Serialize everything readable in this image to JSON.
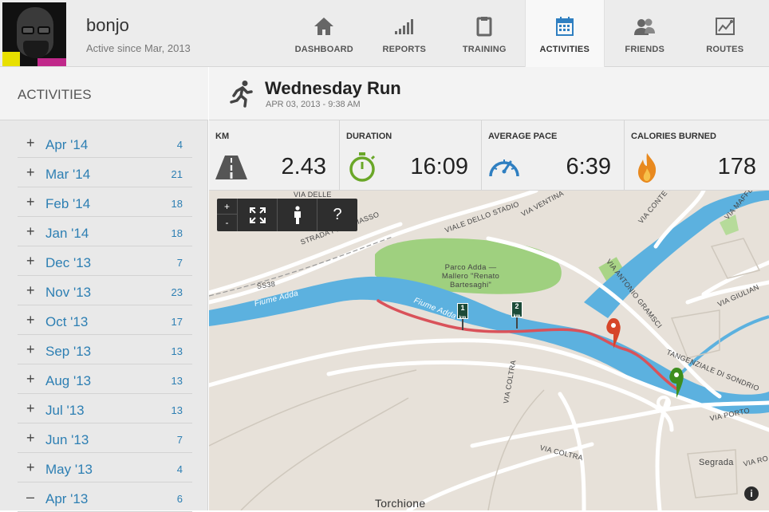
{
  "user": {
    "name": "bonjo",
    "since": "Active since Mar, 2013"
  },
  "nav": {
    "tabs": [
      {
        "label": "DASHBOARD",
        "icon": "home-icon"
      },
      {
        "label": "REPORTS",
        "icon": "bar-chart-icon"
      },
      {
        "label": "TRAINING",
        "icon": "clipboard-icon"
      },
      {
        "label": "ACTIVITIES",
        "icon": "calendar-icon",
        "active": true
      },
      {
        "label": "FRIENDS",
        "icon": "friends-icon"
      },
      {
        "label": "ROUTES",
        "icon": "route-map-icon"
      }
    ]
  },
  "sidebar": {
    "title": "ACTIVITIES",
    "months": [
      {
        "sign": "+",
        "label": "Apr '14",
        "count": "4"
      },
      {
        "sign": "+",
        "label": "Mar '14",
        "count": "21"
      },
      {
        "sign": "+",
        "label": "Feb '14",
        "count": "18"
      },
      {
        "sign": "+",
        "label": "Jan '14",
        "count": "18"
      },
      {
        "sign": "+",
        "label": "Dec '13",
        "count": "7"
      },
      {
        "sign": "+",
        "label": "Nov '13",
        "count": "23"
      },
      {
        "sign": "+",
        "label": "Oct '13",
        "count": "17"
      },
      {
        "sign": "+",
        "label": "Sep '13",
        "count": "13"
      },
      {
        "sign": "+",
        "label": "Aug '13",
        "count": "13"
      },
      {
        "sign": "+",
        "label": "Jul '13",
        "count": "13"
      },
      {
        "sign": "+",
        "label": "Jun '13",
        "count": "7"
      },
      {
        "sign": "+",
        "label": "May '13",
        "count": "4"
      },
      {
        "sign": "–",
        "label": "Apr '13",
        "count": "6"
      }
    ]
  },
  "activity": {
    "title": "Wednesday Run",
    "date": "APR 03, 2013  -  9:38 AM",
    "icon": "runner-icon"
  },
  "stats": [
    {
      "label": "KM",
      "value": "2.43",
      "icon": "road-icon"
    },
    {
      "label": "DURATION",
      "value": "16:09",
      "icon": "stopwatch-icon"
    },
    {
      "label": "AVERAGE PACE",
      "value": "6:39",
      "icon": "speedometer-icon"
    },
    {
      "label": "CALORIES BURNED",
      "value": "178",
      "icon": "flame-icon"
    }
  ],
  "map": {
    "toolbar": {
      "zoom_in": "+",
      "zoom_out": "-",
      "help": "?"
    },
    "km_markers": [
      "1 km",
      "2 km"
    ],
    "labels": {
      "park": "Parco Adda — Mallero \"Renato Bartesaghi\"",
      "river1": "Fiume Adda",
      "river2": "Fiume Adda",
      "viale_stadio": "VIALE DELLO STADIO",
      "via_ventina": "VIA VENTINA",
      "strada_triasso": "STRADA PER TRIASSO",
      "ss38": "SS38",
      "via_delle": "VIA DELLE",
      "via_gramsci": "VIA ANTONIO GRAMSCI",
      "via_cl": "VIA CONTE L",
      "via_maffei": "VIA MAFFE",
      "via_giuliani": "VIA GIULIAN",
      "tangenziale": "TANGENZIALE DI SONDRIO",
      "via_porto": "VIA PORTO",
      "via_coltra1": "VIA COLTRA",
      "via_coltra2": "VIA COLTRA",
      "segrada": "Segrada",
      "via_ro": "VIA RO",
      "torchione": "Torchione"
    },
    "info": "i",
    "colors": {
      "water": "#5cb1df",
      "park": "#9fd07f",
      "route": "#d9525a",
      "start_pin": "#3e8e1e",
      "end_pin": "#d64529"
    }
  }
}
